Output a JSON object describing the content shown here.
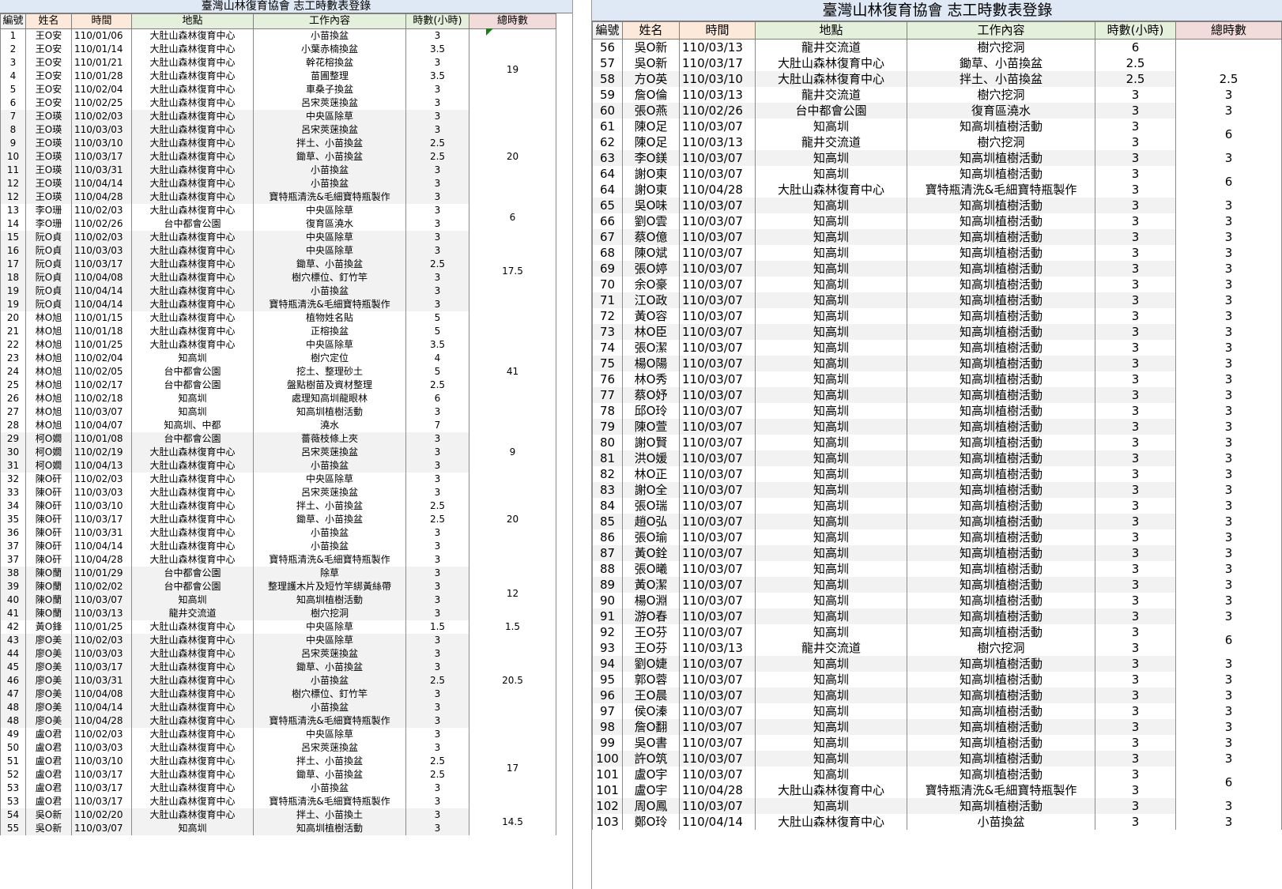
{
  "left": {
    "title": "臺灣山林復育協會 志工時數表登錄",
    "headers": [
      "編號",
      "姓名",
      "時間",
      "地點",
      "工作內容",
      "時數(小時)",
      "總時數"
    ],
    "rows": [
      [
        "1",
        "王O安",
        "110/01/06",
        "大肚山森林復育中心",
        "小苗換盆",
        "3"
      ],
      [
        "2",
        "王O安",
        "110/01/14",
        "大肚山森林復育中心",
        "小葉赤楠換盆",
        "3.5"
      ],
      [
        "3",
        "王O安",
        "110/01/21",
        "大肚山森林復育中心",
        "幹花榕換盆",
        "3"
      ],
      [
        "4",
        "王O安",
        "110/01/28",
        "大肚山森林復育中心",
        "苗圃整理",
        "3.5"
      ],
      [
        "5",
        "王O安",
        "110/02/04",
        "大肚山森林復育中心",
        "車桑子換盆",
        "3"
      ],
      [
        "6",
        "王O安",
        "110/02/25",
        "大肚山森林復育中心",
        "呂宋莢蒾換盆",
        "3"
      ],
      [
        "7",
        "王O瑛",
        "110/02/03",
        "大肚山森林復育中心",
        "中央區除草",
        "3"
      ],
      [
        "8",
        "王O瑛",
        "110/03/03",
        "大肚山森林復育中心",
        "呂宋莢蒾換盆",
        "3"
      ],
      [
        "9",
        "王O瑛",
        "110/03/10",
        "大肚山森林復育中心",
        "拌土、小苗換盆",
        "2.5"
      ],
      [
        "10",
        "王O瑛",
        "110/03/17",
        "大肚山森林復育中心",
        "鋤草、小苗換盆",
        "2.5"
      ],
      [
        "11",
        "王O瑛",
        "110/03/31",
        "大肚山森林復育中心",
        "小苗換盆",
        "3"
      ],
      [
        "12",
        "王O瑛",
        "110/04/14",
        "大肚山森林復育中心",
        "小苗換盆",
        "3"
      ],
      [
        "12",
        "王O瑛",
        "110/04/28",
        "大肚山森林復育中心",
        "寶特瓶清洗&毛細寶特瓶製作",
        "3"
      ],
      [
        "13",
        "李O珊",
        "110/02/03",
        "大肚山森林復育中心",
        "中央區除草",
        "3"
      ],
      [
        "14",
        "李O珊",
        "110/02/26",
        "台中都會公園",
        "復育區澆水",
        "3"
      ],
      [
        "15",
        "阮O貞",
        "110/02/03",
        "大肚山森林復育中心",
        "中央區除草",
        "3"
      ],
      [
        "16",
        "阮O貞",
        "110/03/03",
        "大肚山森林復育中心",
        "中央區除草",
        "3"
      ],
      [
        "17",
        "阮O貞",
        "110/03/17",
        "大肚山森林復育中心",
        "鋤草、小苗換盆",
        "2.5"
      ],
      [
        "18",
        "阮O貞",
        "110/04/08",
        "大肚山森林復育中心",
        "樹穴標位、釘竹竿",
        "3"
      ],
      [
        "19",
        "阮O貞",
        "110/04/14",
        "大肚山森林復育中心",
        "小苗換盆",
        "3"
      ],
      [
        "19",
        "阮O貞",
        "110/04/14",
        "大肚山森林復育中心",
        "寶特瓶清洗&毛細寶特瓶製作",
        "3"
      ],
      [
        "20",
        "林O旭",
        "110/01/15",
        "大肚山森林復育中心",
        "植物姓名貼",
        "5"
      ],
      [
        "21",
        "林O旭",
        "110/01/18",
        "大肚山森林復育中心",
        "正榕換盆",
        "5"
      ],
      [
        "22",
        "林O旭",
        "110/01/25",
        "大肚山森林復育中心",
        "中央區除草",
        "3.5"
      ],
      [
        "23",
        "林O旭",
        "110/02/04",
        "知高圳",
        "樹穴定位",
        "4"
      ],
      [
        "24",
        "林O旭",
        "110/02/05",
        "台中都會公園",
        "挖土、整理砂土",
        "5"
      ],
      [
        "25",
        "林O旭",
        "110/02/17",
        "台中都會公園",
        "盤點樹苗及資材整理",
        "2.5"
      ],
      [
        "26",
        "林O旭",
        "110/02/18",
        "知高圳",
        "處理知高圳龍眼林",
        "6"
      ],
      [
        "27",
        "林O旭",
        "110/03/07",
        "知高圳",
        "知高圳植樹活動",
        "3"
      ],
      [
        "28",
        "林O旭",
        "110/04/07",
        "知高圳、中都",
        "澆水",
        "7"
      ],
      [
        "29",
        "柯O嫺",
        "110/01/08",
        "台中都會公園",
        "薔薇枝條上夾",
        "3"
      ],
      [
        "30",
        "柯O嫺",
        "110/02/19",
        "大肚山森林復育中心",
        "呂宋莢蒾換盆",
        "3"
      ],
      [
        "31",
        "柯O嫺",
        "110/04/13",
        "大肚山森林復育中心",
        "小苗換盆",
        "3"
      ],
      [
        "32",
        "陳O矸",
        "110/02/03",
        "大肚山森林復育中心",
        "中央區除草",
        "3"
      ],
      [
        "33",
        "陳O矸",
        "110/03/03",
        "大肚山森林復育中心",
        "呂宋莢蒾換盆",
        "3"
      ],
      [
        "34",
        "陳O矸",
        "110/03/10",
        "大肚山森林復育中心",
        "拌土、小苗換盆",
        "2.5"
      ],
      [
        "35",
        "陳O矸",
        "110/03/17",
        "大肚山森林復育中心",
        "鋤草、小苗換盆",
        "2.5"
      ],
      [
        "36",
        "陳O矸",
        "110/03/31",
        "大肚山森林復育中心",
        "小苗換盆",
        "3"
      ],
      [
        "37",
        "陳O矸",
        "110/04/14",
        "大肚山森林復育中心",
        "小苗換盆",
        "3"
      ],
      [
        "37",
        "陳O矸",
        "110/04/28",
        "大肚山森林復育中心",
        "寶特瓶清洗&毛細寶特瓶製作",
        "3"
      ],
      [
        "38",
        "陳O蘭",
        "110/01/29",
        "台中都會公園",
        "除草",
        "3"
      ],
      [
        "39",
        "陳O蘭",
        "110/02/02",
        "台中都會公園",
        "整理護木片及短竹竿綁黃絲帶",
        "3"
      ],
      [
        "40",
        "陳O蘭",
        "110/03/07",
        "知高圳",
        "知高圳植樹活動",
        "3"
      ],
      [
        "41",
        "陳O蘭",
        "110/03/13",
        "龍井交流道",
        "樹穴挖洞",
        "3"
      ],
      [
        "42",
        "黃O鋒",
        "110/01/25",
        "大肚山森林復育中心",
        "中央區除草",
        "1.5"
      ],
      [
        "43",
        "廖O美",
        "110/02/03",
        "大肚山森林復育中心",
        "中央區除草",
        "3"
      ],
      [
        "44",
        "廖O美",
        "110/03/03",
        "大肚山森林復育中心",
        "呂宋莢蒾換盆",
        "3"
      ],
      [
        "45",
        "廖O美",
        "110/03/17",
        "大肚山森林復育中心",
        "鋤草、小苗換盆",
        "3"
      ],
      [
        "46",
        "廖O美",
        "110/03/31",
        "大肚山森林復育中心",
        "小苗換盆",
        "2.5"
      ],
      [
        "47",
        "廖O美",
        "110/04/08",
        "大肚山森林復育中心",
        "樹穴標位、釘竹竿",
        "3"
      ],
      [
        "48",
        "廖O美",
        "110/04/14",
        "大肚山森林復育中心",
        "小苗換盆",
        "3"
      ],
      [
        "48",
        "廖O美",
        "110/04/28",
        "大肚山森林復育中心",
        "寶特瓶清洗&毛細寶特瓶製作",
        "3"
      ],
      [
        "49",
        "盧O君",
        "110/02/03",
        "大肚山森林復育中心",
        "中央區除草",
        "3"
      ],
      [
        "50",
        "盧O君",
        "110/03/03",
        "大肚山森林復育中心",
        "呂宋莢蒾換盆",
        "3"
      ],
      [
        "51",
        "盧O君",
        "110/03/10",
        "大肚山森林復育中心",
        "拌土、小苗換盆",
        "2.5"
      ],
      [
        "52",
        "盧O君",
        "110/03/17",
        "大肚山森林復育中心",
        "鋤草、小苗換盆",
        "2.5"
      ],
      [
        "53",
        "盧O君",
        "110/03/17",
        "大肚山森林復育中心",
        "小苗換盆",
        "3"
      ],
      [
        "53",
        "盧O君",
        "110/03/17",
        "大肚山森林復育中心",
        "寶特瓶清洗&毛細寶特瓶製作",
        "3"
      ],
      [
        "54",
        "吳O新",
        "110/02/20",
        "大肚山森林復育中心",
        "拌土、小苗換土",
        "3"
      ],
      [
        "55",
        "吳O新",
        "110/03/07",
        "知高圳",
        "知高圳植樹活動",
        "3"
      ]
    ],
    "groups": [
      {
        "start": 0,
        "count": 6,
        "total": "19"
      },
      {
        "start": 6,
        "count": 7,
        "total": "20"
      },
      {
        "start": 13,
        "count": 2,
        "total": "6"
      },
      {
        "start": 15,
        "count": 6,
        "total": "17.5"
      },
      {
        "start": 21,
        "count": 9,
        "total": "41"
      },
      {
        "start": 30,
        "count": 3,
        "total": "9"
      },
      {
        "start": 33,
        "count": 7,
        "total": "20"
      },
      {
        "start": 40,
        "count": 4,
        "total": "12"
      },
      {
        "start": 44,
        "count": 1,
        "total": "1.5"
      },
      {
        "start": 45,
        "count": 7,
        "total": "20.5"
      },
      {
        "start": 52,
        "count": 6,
        "total": "17"
      },
      {
        "start": 58,
        "count": 2,
        "total": "14.5"
      }
    ]
  },
  "right": {
    "title": "臺灣山林復育協會 志工時數表登錄",
    "headers": [
      "編號",
      "姓名",
      "時間",
      "地點",
      "工作內容",
      "時數(小時)",
      "總時數"
    ],
    "rows": [
      [
        "56",
        "吳O新",
        "110/03/13",
        "龍井交流道",
        "樹穴挖洞",
        "6"
      ],
      [
        "57",
        "吳O新",
        "110/03/17",
        "大肚山森林復育中心",
        "鋤草、小苗換盆",
        "2.5"
      ],
      [
        "58",
        "方O英",
        "110/03/10",
        "大肚山森林復育中心",
        "拌土、小苗換盆",
        "2.5"
      ],
      [
        "59",
        "詹O倫",
        "110/03/13",
        "龍井交流道",
        "樹穴挖洞",
        "3"
      ],
      [
        "60",
        "張O燕",
        "110/02/26",
        "台中都會公園",
        "復育區澆水",
        "3"
      ],
      [
        "61",
        "陳O足",
        "110/03/07",
        "知高圳",
        "知高圳植樹活動",
        "3"
      ],
      [
        "62",
        "陳O足",
        "110/03/13",
        "龍井交流道",
        "樹穴挖洞",
        "3"
      ],
      [
        "63",
        "李O鎂",
        "110/03/07",
        "知高圳",
        "知高圳植樹活動",
        "3"
      ],
      [
        "64",
        "謝O東",
        "110/03/07",
        "知高圳",
        "知高圳植樹活動",
        "3"
      ],
      [
        "64",
        "謝O東",
        "110/04/28",
        "大肚山森林復育中心",
        "寶特瓶清洗&毛細寶特瓶製作",
        "3"
      ],
      [
        "65",
        "吳O味",
        "110/03/07",
        "知高圳",
        "知高圳植樹活動",
        "3"
      ],
      [
        "66",
        "劉O雲",
        "110/03/07",
        "知高圳",
        "知高圳植樹活動",
        "3"
      ],
      [
        "67",
        "蔡O億",
        "110/03/07",
        "知高圳",
        "知高圳植樹活動",
        "3"
      ],
      [
        "68",
        "陳O斌",
        "110/03/07",
        "知高圳",
        "知高圳植樹活動",
        "3"
      ],
      [
        "69",
        "張O婷",
        "110/03/07",
        "知高圳",
        "知高圳植樹活動",
        "3"
      ],
      [
        "70",
        "余O豪",
        "110/03/07",
        "知高圳",
        "知高圳植樹活動",
        "3"
      ],
      [
        "71",
        "江O政",
        "110/03/07",
        "知高圳",
        "知高圳植樹活動",
        "3"
      ],
      [
        "72",
        "黃O容",
        "110/03/07",
        "知高圳",
        "知高圳植樹活動",
        "3"
      ],
      [
        "73",
        "林O臣",
        "110/03/07",
        "知高圳",
        "知高圳植樹活動",
        "3"
      ],
      [
        "74",
        "張O潔",
        "110/03/07",
        "知高圳",
        "知高圳植樹活動",
        "3"
      ],
      [
        "75",
        "楊O陽",
        "110/03/07",
        "知高圳",
        "知高圳植樹活動",
        "3"
      ],
      [
        "76",
        "林O秀",
        "110/03/07",
        "知高圳",
        "知高圳植樹活動",
        "3"
      ],
      [
        "77",
        "蔡O妤",
        "110/03/07",
        "知高圳",
        "知高圳植樹活動",
        "3"
      ],
      [
        "78",
        "邱O玲",
        "110/03/07",
        "知高圳",
        "知高圳植樹活動",
        "3"
      ],
      [
        "79",
        "陳O萱",
        "110/03/07",
        "知高圳",
        "知高圳植樹活動",
        "3"
      ],
      [
        "80",
        "謝O賢",
        "110/03/07",
        "知高圳",
        "知高圳植樹活動",
        "3"
      ],
      [
        "81",
        "洪O媛",
        "110/03/07",
        "知高圳",
        "知高圳植樹活動",
        "3"
      ],
      [
        "82",
        "林O正",
        "110/03/07",
        "知高圳",
        "知高圳植樹活動",
        "3"
      ],
      [
        "83",
        "謝O全",
        "110/03/07",
        "知高圳",
        "知高圳植樹活動",
        "3"
      ],
      [
        "84",
        "張O瑞",
        "110/03/07",
        "知高圳",
        "知高圳植樹活動",
        "3"
      ],
      [
        "85",
        "趙O弘",
        "110/03/07",
        "知高圳",
        "知高圳植樹活動",
        "3"
      ],
      [
        "86",
        "張O瑜",
        "110/03/07",
        "知高圳",
        "知高圳植樹活動",
        "3"
      ],
      [
        "87",
        "黃O銓",
        "110/03/07",
        "知高圳",
        "知高圳植樹活動",
        "3"
      ],
      [
        "88",
        "張O曦",
        "110/03/07",
        "知高圳",
        "知高圳植樹活動",
        "3"
      ],
      [
        "89",
        "黃O潔",
        "110/03/07",
        "知高圳",
        "知高圳植樹活動",
        "3"
      ],
      [
        "90",
        "楊O淵",
        "110/03/07",
        "知高圳",
        "知高圳植樹活動",
        "3"
      ],
      [
        "91",
        "游O春",
        "110/03/07",
        "知高圳",
        "知高圳植樹活動",
        "3"
      ],
      [
        "92",
        "王O芬",
        "110/03/07",
        "知高圳",
        "知高圳植樹活動",
        "3"
      ],
      [
        "93",
        "王O芬",
        "110/03/13",
        "龍井交流道",
        "樹穴挖洞",
        "3"
      ],
      [
        "94",
        "劉O婕",
        "110/03/07",
        "知高圳",
        "知高圳植樹活動",
        "3"
      ],
      [
        "95",
        "郭O蓉",
        "110/03/07",
        "知高圳",
        "知高圳植樹活動",
        "3"
      ],
      [
        "96",
        "王O晨",
        "110/03/07",
        "知高圳",
        "知高圳植樹活動",
        "3"
      ],
      [
        "97",
        "侯O溱",
        "110/03/07",
        "知高圳",
        "知高圳植樹活動",
        "3"
      ],
      [
        "98",
        "詹O翻",
        "110/03/07",
        "知高圳",
        "知高圳植樹活動",
        "3"
      ],
      [
        "99",
        "吳O書",
        "110/03/07",
        "知高圳",
        "知高圳植樹活動",
        "3"
      ],
      [
        "100",
        "許O筑",
        "110/03/07",
        "知高圳",
        "知高圳植樹活動",
        "3"
      ],
      [
        "101",
        "盧O宇",
        "110/03/07",
        "知高圳",
        "知高圳植樹活動",
        "3"
      ],
      [
        "101",
        "盧O宇",
        "110/04/28",
        "大肚山森林復育中心",
        "寶特瓶清洗&毛細寶特瓶製作",
        "3"
      ],
      [
        "102",
        "周O鳳",
        "110/03/07",
        "知高圳",
        "知高圳植樹活動",
        "3"
      ],
      [
        "103",
        "鄭O玲",
        "110/04/14",
        "大肚山森林復育中心",
        "小苗換盆",
        "3"
      ]
    ],
    "groups": [
      {
        "start": 0,
        "count": 2,
        "total": ""
      },
      {
        "start": 2,
        "count": 1,
        "total": "2.5"
      },
      {
        "start": 3,
        "count": 1,
        "total": "3"
      },
      {
        "start": 4,
        "count": 1,
        "total": "3"
      },
      {
        "start": 5,
        "count": 2,
        "total": "6"
      },
      {
        "start": 7,
        "count": 1,
        "total": "3"
      },
      {
        "start": 8,
        "count": 2,
        "total": "6"
      },
      {
        "start": 10,
        "count": 1,
        "total": "3"
      },
      {
        "start": 11,
        "count": 1,
        "total": "3"
      },
      {
        "start": 12,
        "count": 1,
        "total": "3"
      },
      {
        "start": 13,
        "count": 1,
        "total": "3"
      },
      {
        "start": 14,
        "count": 1,
        "total": "3"
      },
      {
        "start": 15,
        "count": 1,
        "total": "3"
      },
      {
        "start": 16,
        "count": 1,
        "total": "3"
      },
      {
        "start": 17,
        "count": 1,
        "total": "3"
      },
      {
        "start": 18,
        "count": 1,
        "total": "3"
      },
      {
        "start": 19,
        "count": 1,
        "total": "3"
      },
      {
        "start": 20,
        "count": 1,
        "total": "3"
      },
      {
        "start": 21,
        "count": 1,
        "total": "3"
      },
      {
        "start": 22,
        "count": 1,
        "total": "3"
      },
      {
        "start": 23,
        "count": 1,
        "total": "3"
      },
      {
        "start": 24,
        "count": 1,
        "total": "3"
      },
      {
        "start": 25,
        "count": 1,
        "total": "3"
      },
      {
        "start": 26,
        "count": 1,
        "total": "3"
      },
      {
        "start": 27,
        "count": 1,
        "total": "3"
      },
      {
        "start": 28,
        "count": 1,
        "total": "3"
      },
      {
        "start": 29,
        "count": 1,
        "total": "3"
      },
      {
        "start": 30,
        "count": 1,
        "total": "3"
      },
      {
        "start": 31,
        "count": 1,
        "total": "3"
      },
      {
        "start": 32,
        "count": 1,
        "total": "3"
      },
      {
        "start": 33,
        "count": 1,
        "total": "3"
      },
      {
        "start": 34,
        "count": 1,
        "total": "3"
      },
      {
        "start": 35,
        "count": 1,
        "total": "3"
      },
      {
        "start": 36,
        "count": 1,
        "total": "3"
      },
      {
        "start": 37,
        "count": 2,
        "total": "6"
      },
      {
        "start": 39,
        "count": 1,
        "total": "3"
      },
      {
        "start": 40,
        "count": 1,
        "total": "3"
      },
      {
        "start": 41,
        "count": 1,
        "total": "3"
      },
      {
        "start": 42,
        "count": 1,
        "total": "3"
      },
      {
        "start": 43,
        "count": 1,
        "total": "3"
      },
      {
        "start": 44,
        "count": 1,
        "total": "3"
      },
      {
        "start": 45,
        "count": 1,
        "total": "3"
      },
      {
        "start": 46,
        "count": 2,
        "total": "6"
      },
      {
        "start": 48,
        "count": 1,
        "total": "3"
      },
      {
        "start": 49,
        "count": 1,
        "total": "3"
      }
    ]
  }
}
